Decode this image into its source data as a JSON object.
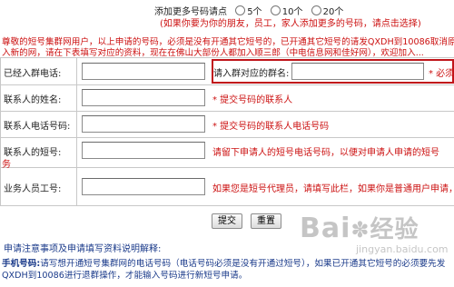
{
  "top": {
    "add_more_prefix": "添加更多号码请点",
    "options": [
      "5个",
      "10个",
      "20个"
    ],
    "hint": "(如果你要为你的朋友，员工，家人添加更多的号码，请点击选择)"
  },
  "intro": {
    "line1": "尊敬的短号集群网用户，以上申请的号码，必须是没有开通其它短号的，已开通其它短号的请发QXDH到10086取消原有网",
    "line2": "入新的网，请在下表填写对应的资料，现在在佛山大部份人都加入顺三郎（中电信息网和佳好网），欢迎加入..."
  },
  "form": {
    "joined_phone_label": "已经入群电话:",
    "group_label": "请入群对应的群名:",
    "group_required": "* 必须",
    "contact_name_label": "联系人的姓名:",
    "contact_name_hint": "* 提交号码的联系人",
    "contact_phone_label": "联系人电话号码:",
    "contact_phone_hint": "* 提交号码的联系人电话号码",
    "contact_short_label": "联系人的短号:",
    "contact_short_hint_1": "请留下申请人的短号电话号码，以便对申请人申请的短号",
    "contact_short_hint_2": "务",
    "staff_id_label": "业务人员工号:",
    "staff_id_hint": "如果您是短号代理员，请填写此栏，如果你是普通用户申请，则"
  },
  "buttons": {
    "submit": "提交",
    "reset": "重置"
  },
  "notes": {
    "title": "申请注意事项及申请填写资料说明解释:",
    "item_label": "手机号码:",
    "item_text_1": "请写想开通短号集群网的电话号码（电话号码必须是没有开通过短号），如果已开通其它短号的必须要先发",
    "item_text_2": "QXDH到10086进行退群操作，才能输入号码进行新短号申请。"
  },
  "watermark": {
    "brand": "Bai",
    "brand2": "经验",
    "sub": "jingyan.baidu.com"
  },
  "colors": {
    "required_red": "#cc1111",
    "highlight_red": "#c0141a",
    "note_blue": "#1a3a8a"
  }
}
